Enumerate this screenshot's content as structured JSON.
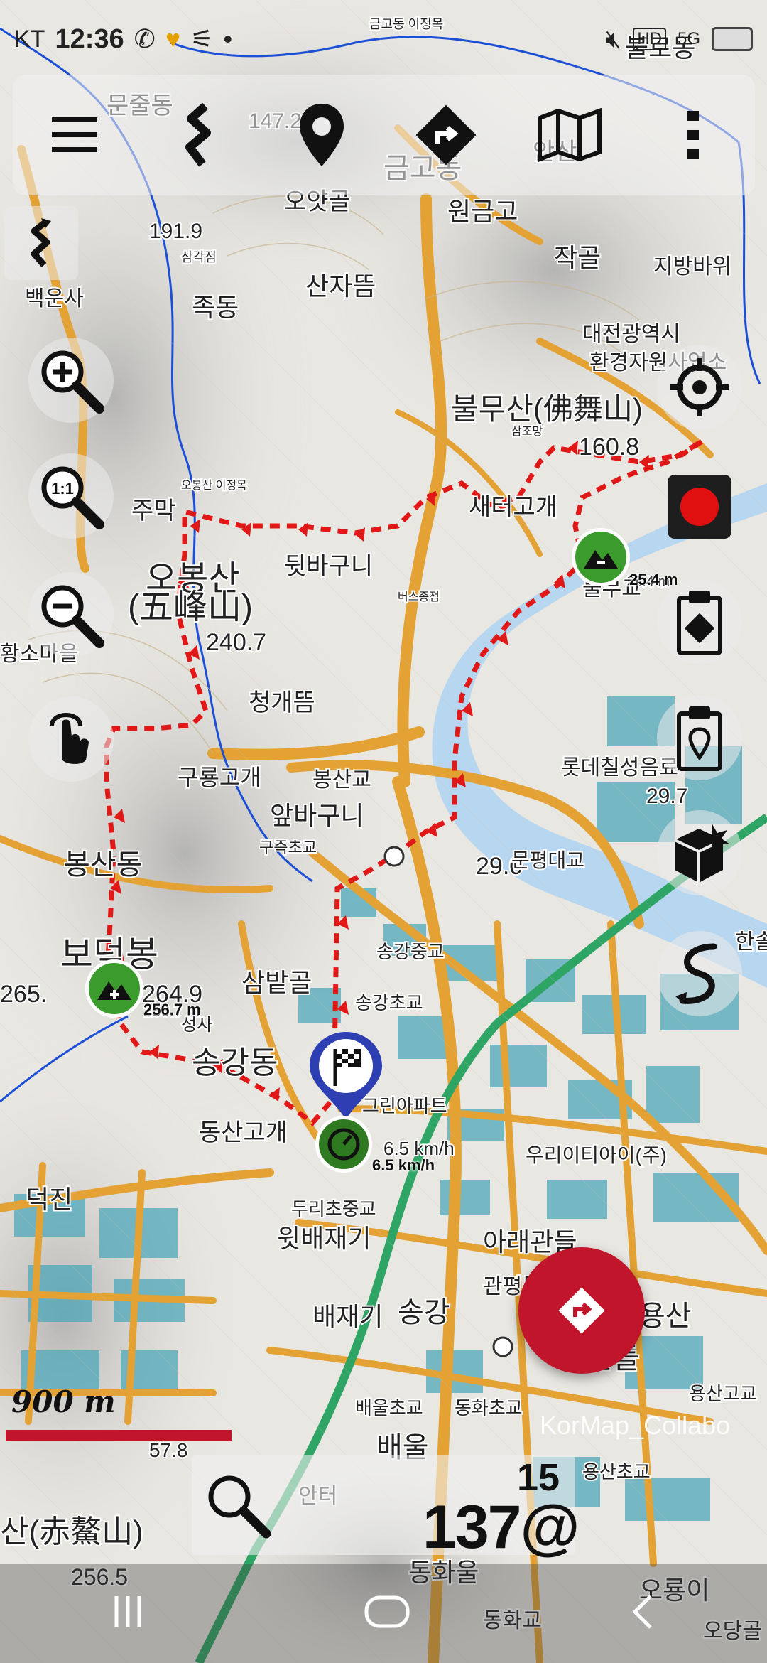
{
  "status_bar": {
    "carrier": "KT",
    "time": "12:36",
    "network_badge": "5G",
    "icons": [
      "phone-call-icon",
      "heart-icon",
      "signal-icon",
      "dot-icon",
      "mute-icon",
      "hd-icon",
      "battery-icon"
    ]
  },
  "toolbar": {
    "items": [
      "menu-icon",
      "route-icon",
      "location-pin-icon",
      "directions-icon",
      "map-icon",
      "more-icon"
    ]
  },
  "side_controls": {
    "left": [
      "route-small-icon",
      "zoom-in-icon",
      "zoom-reset-icon",
      "zoom-out-icon",
      "touch-icon"
    ],
    "right": [
      "target-icon",
      "record-icon",
      "clipboard-route-icon",
      "clipboard-pin-icon",
      "package-icon",
      "trace-icon"
    ]
  },
  "map_labels": [
    "문줄동",
    "147.2",
    "금고동",
    "오얏골",
    "원금고",
    "작골",
    "지방바위",
    "191.9",
    "삼각점",
    "백운사",
    "족동",
    "산자뜸",
    "대전광역시",
    "환경자원사업소",
    "불무산(佛舞山)",
    "160.8",
    "삼조망",
    "오봉산 이정목",
    "주막",
    "새터고개",
    "뒷바구니",
    "25.4 m",
    "불무교",
    "오봉산",
    "(五峰山)",
    "240.7",
    "버스종점",
    "청개뜸",
    "롯데칠성음료",
    "29.7",
    "황소마을",
    "구룡고개",
    "봉산교",
    "앞바구니",
    "구즉초교",
    "29.0",
    "문평대교",
    "봉산동",
    "보덕봉",
    "265.",
    "264.9",
    "256.7 m",
    "성사",
    "삼밭골",
    "송강중교",
    "송강초교",
    "송강동",
    "그린아파트",
    "동산고개",
    "6.5 km/h",
    "우리이티아이(주)",
    "덕진",
    "두리초중교",
    "윗배재기",
    "아래관들",
    "배재기",
    "송강",
    "관평동",
    "용산",
    "윗관들",
    "용산고교",
    "배울초교",
    "동화초교",
    "57.8",
    "배울",
    "용산초교",
    "안터",
    "산(赤鰲山)",
    "256.5",
    "동화울",
    "오룡이",
    "동화교",
    "오당골",
    "금고동 이정목",
    "불로동",
    "안산",
    "한솔"
  ],
  "markers": {
    "summit_left_label": "256.7 m",
    "summit_right_label": "25.4 m",
    "speed_label": "6.5 km/h"
  },
  "scale": {
    "label": "900 m"
  },
  "copyright": "KorMap_Collabo",
  "bottom_panel": {
    "distance": "137@",
    "superscript": "15",
    "search_icon": "search-icon"
  },
  "nav_bar": [
    "recents-icon",
    "home-icon",
    "back-icon"
  ],
  "colors": {
    "route_red": "#e01818",
    "fab_red": "#c0152a",
    "road_orange": "#e3a233",
    "water_blue": "#b7d6ef",
    "rail_green": "#2fa565"
  }
}
